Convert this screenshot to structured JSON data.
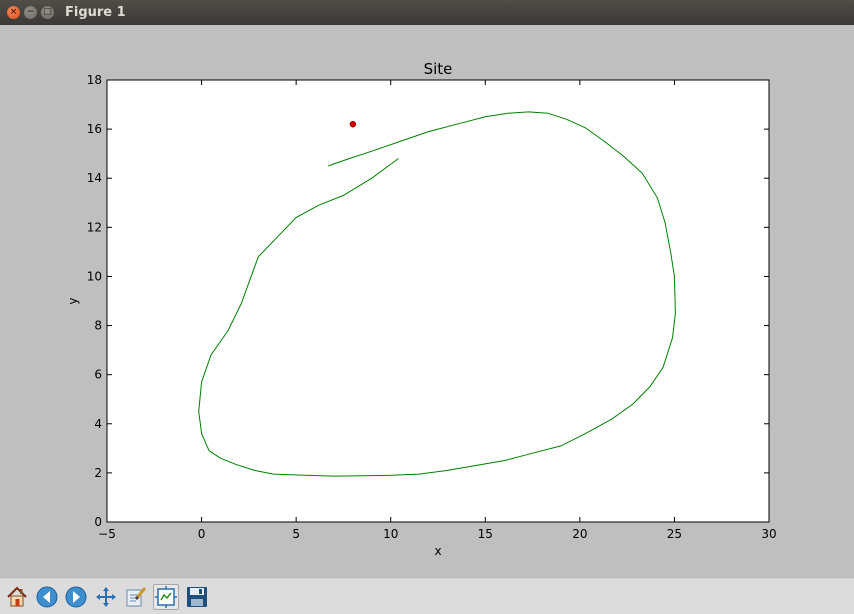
{
  "window": {
    "title": "Figure 1",
    "close_glyph": "×",
    "min_glyph": "−",
    "max_glyph": "□"
  },
  "toolbar": {
    "buttons": [
      {
        "name": "home-icon"
      },
      {
        "name": "back-icon"
      },
      {
        "name": "forward-icon"
      },
      {
        "name": "pan-icon"
      },
      {
        "name": "zoom-icon"
      },
      {
        "name": "configure-subplots-icon"
      },
      {
        "name": "save-icon"
      }
    ]
  },
  "chart_data": {
    "type": "line",
    "title": "Site",
    "xlabel": "x",
    "ylabel": "y",
    "xlim": [
      -5,
      30
    ],
    "ylim": [
      0,
      18
    ],
    "xticks": [
      -5,
      0,
      5,
      10,
      15,
      20,
      25,
      30
    ],
    "yticks": [
      0,
      2,
      4,
      6,
      8,
      10,
      12,
      14,
      16,
      18
    ],
    "grid": false,
    "series": [
      {
        "color": "#008000",
        "x": [
          6.7,
          7.8,
          9.0,
          10.5,
          12.0,
          13.5,
          15.0,
          16.2,
          17.3,
          18.3,
          19.3,
          20.3,
          21.3,
          22.3,
          23.3,
          24.1,
          24.5,
          24.8,
          25.0,
          25.05,
          24.9,
          24.4,
          23.7,
          22.8,
          21.7,
          20.3,
          19.0,
          17.5,
          16.0,
          14.5,
          13.0,
          11.5,
          10.0,
          8.5,
          7.0,
          5.5,
          3.8,
          2.8,
          1.8,
          1.0,
          0.4,
          0.0,
          -0.15,
          0.0,
          0.5,
          1.4,
          2.1,
          3.0,
          4.0,
          5.0,
          6.2,
          7.5,
          9.0,
          10.4
        ],
        "y": [
          14.5,
          14.8,
          15.1,
          15.5,
          15.9,
          16.2,
          16.5,
          16.65,
          16.7,
          16.65,
          16.4,
          16.05,
          15.5,
          14.9,
          14.2,
          13.2,
          12.2,
          11.0,
          10.0,
          8.5,
          7.5,
          6.3,
          5.5,
          4.8,
          4.2,
          3.6,
          3.1,
          2.8,
          2.5,
          2.3,
          2.1,
          1.95,
          1.9,
          1.88,
          1.87,
          1.9,
          1.95,
          2.1,
          2.35,
          2.6,
          2.9,
          3.6,
          4.5,
          5.7,
          6.8,
          7.8,
          8.9,
          10.8,
          11.6,
          12.4,
          12.9,
          13.3,
          14.0,
          14.8
        ]
      }
    ],
    "points": [
      {
        "x": 8.0,
        "y": 16.2,
        "color": "#cc0000"
      }
    ]
  }
}
